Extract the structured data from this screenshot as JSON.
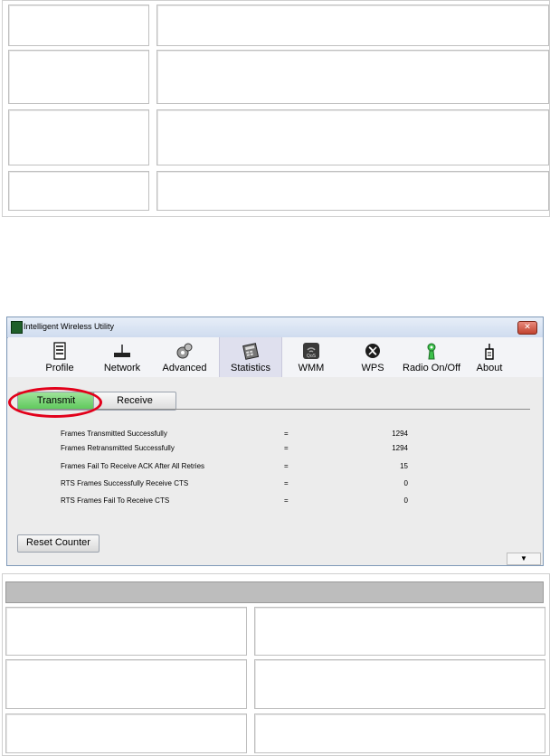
{
  "window": {
    "title": "Intelligent Wireless Utility",
    "close_glyph": "✕"
  },
  "toolbar": {
    "items": [
      {
        "label": "Profile",
        "icon": "profile-icon"
      },
      {
        "label": "Network",
        "icon": "network-icon"
      },
      {
        "label": "Advanced",
        "icon": "advanced-icon"
      },
      {
        "label": "Statistics",
        "icon": "statistics-icon"
      },
      {
        "label": "WMM",
        "icon": "wmm-icon"
      },
      {
        "label": "WPS",
        "icon": "wps-icon"
      },
      {
        "label": "Radio On/Off",
        "icon": "radio-icon"
      },
      {
        "label": "About",
        "icon": "about-icon"
      }
    ],
    "active": "Statistics"
  },
  "tabs": {
    "transmit": "Transmit",
    "receive": "Receive"
  },
  "stats": [
    {
      "label": "Frames Transmitted Successfully",
      "sep": "=",
      "value": "1294"
    },
    {
      "label": "Frames Retransmitted Successfully",
      "sep": "=",
      "value": "1294"
    },
    {
      "label": "Frames Fail To Receive ACK After All Retries",
      "sep": "=",
      "value": "15"
    },
    {
      "label": "RTS Frames Successfully Receive CTS",
      "sep": "=",
      "value": "0"
    },
    {
      "label": "RTS Frames Fail To Receive CTS",
      "sep": "=",
      "value": "0"
    }
  ],
  "reset_label": "Reset Counter",
  "scroll_glyph": "▼"
}
